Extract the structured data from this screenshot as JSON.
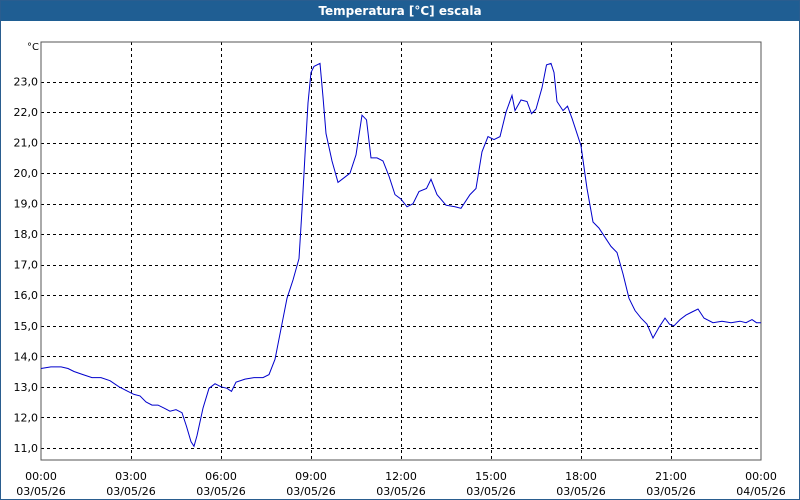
{
  "window": {
    "title": "Temperatura [°C] escala"
  },
  "colors": {
    "title_bar": "#1f5e93",
    "line": "#0000cc",
    "grid": "#000000"
  },
  "chart_data": {
    "type": "line",
    "title": "Temperatura [°C] escala",
    "ylabel": "°C",
    "xlabel": "",
    "grid": true,
    "legend": "none",
    "ylim": [
      10.6,
      24.3
    ],
    "xlim": [
      0,
      24
    ],
    "y_ticks": [
      11,
      12,
      13,
      14,
      15,
      16,
      17,
      18,
      19,
      20,
      21,
      22,
      23
    ],
    "y_tick_labels": [
      "11,0",
      "12,0",
      "13,0",
      "14,0",
      "15,0",
      "16,0",
      "17,0",
      "18,0",
      "19,0",
      "20,0",
      "21,0",
      "22,0",
      "23,0"
    ],
    "x_ticks": [
      {
        "x": 0,
        "time": "00:00",
        "date": "03/05/26"
      },
      {
        "x": 3,
        "time": "03:00",
        "date": "03/05/26"
      },
      {
        "x": 6,
        "time": "06:00",
        "date": "03/05/26"
      },
      {
        "x": 9,
        "time": "09:00",
        "date": "03/05/26"
      },
      {
        "x": 12,
        "time": "12:00",
        "date": "03/05/26"
      },
      {
        "x": 15,
        "time": "15:00",
        "date": "03/05/26"
      },
      {
        "x": 18,
        "time": "18:00",
        "date": "03/05/26"
      },
      {
        "x": 21,
        "time": "21:00",
        "date": "03/05/26"
      },
      {
        "x": 24,
        "time": "00:00",
        "date": "04/05/26"
      }
    ],
    "series": [
      {
        "points": [
          [
            0.0,
            13.6
          ],
          [
            0.33,
            13.65
          ],
          [
            0.67,
            13.65
          ],
          [
            0.9,
            13.6
          ],
          [
            1.1,
            13.5
          ],
          [
            1.4,
            13.4
          ],
          [
            1.7,
            13.3
          ],
          [
            2.0,
            13.3
          ],
          [
            2.3,
            13.2
          ],
          [
            2.6,
            13.0
          ],
          [
            2.9,
            12.85
          ],
          [
            3.1,
            12.75
          ],
          [
            3.3,
            12.7
          ],
          [
            3.5,
            12.5
          ],
          [
            3.7,
            12.4
          ],
          [
            3.9,
            12.4
          ],
          [
            4.1,
            12.3
          ],
          [
            4.3,
            12.2
          ],
          [
            4.5,
            12.25
          ],
          [
            4.7,
            12.15
          ],
          [
            4.85,
            11.7
          ],
          [
            5.0,
            11.2
          ],
          [
            5.1,
            11.05
          ],
          [
            5.2,
            11.4
          ],
          [
            5.4,
            12.3
          ],
          [
            5.6,
            12.95
          ],
          [
            5.8,
            13.1
          ],
          [
            6.0,
            13.0
          ],
          [
            6.2,
            12.95
          ],
          [
            6.35,
            12.85
          ],
          [
            6.5,
            13.15
          ],
          [
            6.8,
            13.25
          ],
          [
            7.1,
            13.3
          ],
          [
            7.4,
            13.3
          ],
          [
            7.6,
            13.4
          ],
          [
            7.8,
            13.9
          ],
          [
            8.0,
            14.9
          ],
          [
            8.2,
            15.9
          ],
          [
            8.4,
            16.5
          ],
          [
            8.6,
            17.2
          ],
          [
            8.7,
            18.8
          ],
          [
            8.8,
            20.6
          ],
          [
            8.9,
            22.3
          ],
          [
            9.0,
            23.3
          ],
          [
            9.1,
            23.5
          ],
          [
            9.3,
            23.6
          ],
          [
            9.4,
            22.5
          ],
          [
            9.5,
            21.3
          ],
          [
            9.7,
            20.4
          ],
          [
            9.9,
            19.7
          ],
          [
            10.1,
            19.85
          ],
          [
            10.3,
            20.0
          ],
          [
            10.5,
            20.6
          ],
          [
            10.7,
            21.9
          ],
          [
            10.85,
            21.75
          ],
          [
            11.0,
            20.5
          ],
          [
            11.2,
            20.5
          ],
          [
            11.4,
            20.4
          ],
          [
            11.6,
            19.9
          ],
          [
            11.8,
            19.3
          ],
          [
            12.0,
            19.15
          ],
          [
            12.2,
            18.9
          ],
          [
            12.4,
            19.0
          ],
          [
            12.6,
            19.4
          ],
          [
            12.85,
            19.5
          ],
          [
            13.0,
            19.8
          ],
          [
            13.2,
            19.3
          ],
          [
            13.5,
            18.95
          ],
          [
            13.8,
            18.9
          ],
          [
            14.0,
            18.85
          ],
          [
            14.3,
            19.3
          ],
          [
            14.5,
            19.5
          ],
          [
            14.7,
            20.7
          ],
          [
            14.9,
            21.2
          ],
          [
            15.1,
            21.1
          ],
          [
            15.3,
            21.2
          ],
          [
            15.5,
            22.0
          ],
          [
            15.7,
            22.55
          ],
          [
            15.8,
            22.05
          ],
          [
            16.0,
            22.4
          ],
          [
            16.2,
            22.35
          ],
          [
            16.35,
            21.95
          ],
          [
            16.5,
            22.1
          ],
          [
            16.7,
            22.8
          ],
          [
            16.85,
            23.55
          ],
          [
            17.0,
            23.6
          ],
          [
            17.1,
            23.3
          ],
          [
            17.2,
            22.35
          ],
          [
            17.4,
            22.05
          ],
          [
            17.55,
            22.2
          ],
          [
            17.7,
            21.8
          ],
          [
            18.0,
            20.9
          ],
          [
            18.2,
            19.5
          ],
          [
            18.4,
            18.4
          ],
          [
            18.6,
            18.2
          ],
          [
            18.8,
            17.9
          ],
          [
            19.0,
            17.6
          ],
          [
            19.2,
            17.4
          ],
          [
            19.4,
            16.7
          ],
          [
            19.6,
            15.9
          ],
          [
            19.8,
            15.5
          ],
          [
            20.0,
            15.25
          ],
          [
            20.2,
            15.05
          ],
          [
            20.4,
            14.6
          ],
          [
            20.6,
            14.95
          ],
          [
            20.8,
            15.25
          ],
          [
            20.95,
            15.05
          ],
          [
            21.1,
            15.0
          ],
          [
            21.3,
            15.2
          ],
          [
            21.5,
            15.35
          ],
          [
            21.7,
            15.45
          ],
          [
            21.9,
            15.55
          ],
          [
            22.1,
            15.25
          ],
          [
            22.4,
            15.1
          ],
          [
            22.7,
            15.15
          ],
          [
            23.0,
            15.1
          ],
          [
            23.3,
            15.15
          ],
          [
            23.5,
            15.1
          ],
          [
            23.7,
            15.2
          ],
          [
            23.85,
            15.1
          ],
          [
            24.0,
            15.1
          ]
        ]
      }
    ]
  }
}
